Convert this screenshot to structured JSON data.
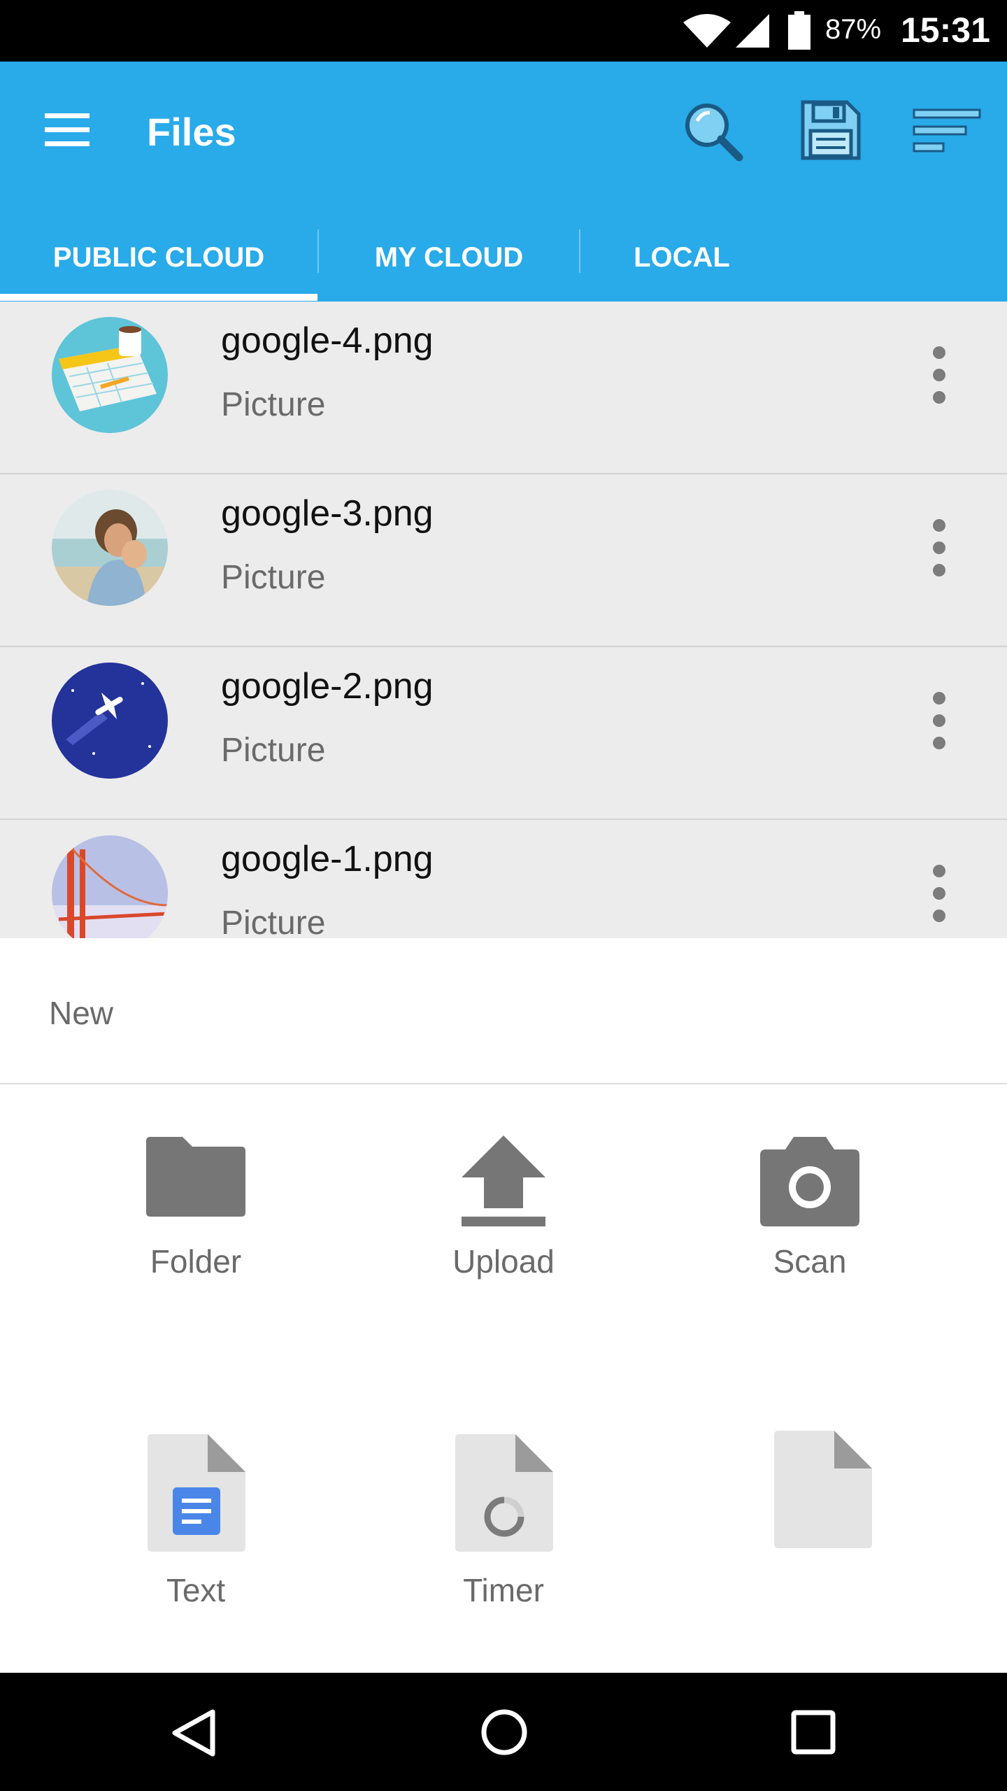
{
  "status_bar": {
    "battery_percent": "87%",
    "time": "15:31"
  },
  "app_bar": {
    "title": "Files",
    "menu_icon": "menu-icon",
    "actions": [
      "search-icon",
      "save-icon",
      "sort-icon"
    ],
    "background": "#29aae9"
  },
  "tabs": [
    {
      "label": "PUBLIC CLOUD",
      "selected": true
    },
    {
      "label": "MY CLOUD",
      "selected": false
    },
    {
      "label": "LOCAL",
      "selected": false
    }
  ],
  "files": [
    {
      "name": "google-4.png",
      "type": "Picture"
    },
    {
      "name": "google-3.png",
      "type": "Picture"
    },
    {
      "name": "google-2.png",
      "type": "Picture"
    },
    {
      "name": "google-1.png",
      "type": "Picture"
    }
  ],
  "sheet": {
    "title": "New",
    "actions": [
      {
        "label": "Folder",
        "icon": "folder-icon"
      },
      {
        "label": "Upload",
        "icon": "upload-icon"
      },
      {
        "label": "Scan",
        "icon": "camera-icon"
      },
      {
        "label": "Text",
        "icon": "text-document-icon"
      },
      {
        "label": "Timer",
        "icon": "timer-document-icon"
      },
      {
        "label": "",
        "icon": "blank-document-icon"
      }
    ]
  },
  "nav_bar": {
    "buttons": [
      "back-icon",
      "home-icon",
      "recents-icon"
    ]
  }
}
